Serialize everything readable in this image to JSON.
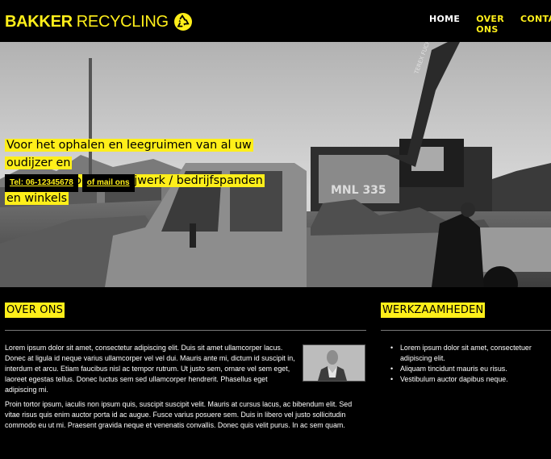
{
  "brand": {
    "name_bold": "BAKKER",
    "name_light": "RECYCLING",
    "icon": "recycle-icon",
    "accent_color": "#ffef1a"
  },
  "nav": {
    "items": [
      {
        "label": "HOME",
        "active": false
      },
      {
        "label": "OVER ONS",
        "active": true
      },
      {
        "label": "CONTACT",
        "active": false
      }
    ]
  },
  "hero": {
    "headline_line1": "Voor het ophalen en leegruimen van al uw oudijzer en",
    "headline_line2": "metalen / sloop en snijwerk / bedrijfspanden en winkels",
    "phone_button": "Tel: 06-12345678",
    "mail_button": "of mail ons",
    "photo_text_crane": "MNL 335",
    "photo_text_brand": "TEREX FUCHS"
  },
  "about": {
    "title": "OVER ONS",
    "paragraph1": "Lorem ipsum dolor sit amet, consectetur adipiscing elit. Duis sit amet ullamcorper lacus. Donec at ligula id neque varius ullamcorper vel vel dui. Mauris ante mi, dictum id suscipit in, interdum et arcu. Etiam faucibus nisl ac tempor rutrum. Ut justo sem, ornare vel sem eget, laoreet egestas tellus. Donec luctus sem sed ullamcorper hendrerit. Phasellus eget adipiscing mi.",
    "paragraph2": "Proin tortor ipsum, iaculis non ipsum quis, suscipit suscipit velit. Mauris at cursus lacus, ac bibendum elit. Sed vitae risus quis enim auctor porta id ac augue. Fusce varius posuere sem. Duis in libero vel justo sollicitudin commodo eu ut mi. Praesent gravida neque et venenatis convallis. Donec quis velit purus. In ac sem quam."
  },
  "work": {
    "title": "WERKZAAMHEDEN",
    "items": [
      "Lorem ipsum dolor sit amet, consectetuer adipiscing elit.",
      "Aliquam tincidunt mauris eu risus.",
      "Vestibulum auctor dapibus neque."
    ]
  }
}
